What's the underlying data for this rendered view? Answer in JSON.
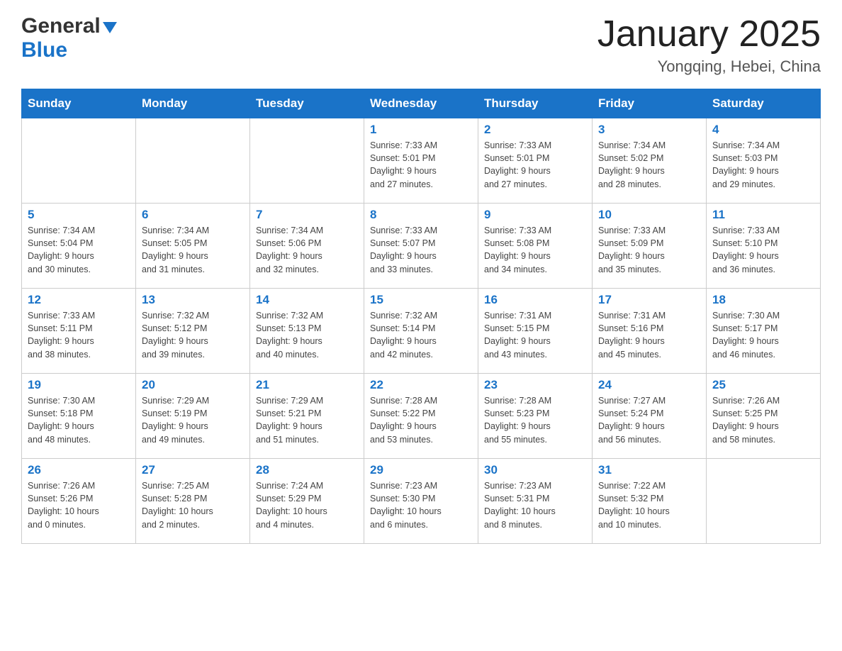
{
  "header": {
    "logo_general": "General",
    "logo_blue": "Blue",
    "title": "January 2025",
    "subtitle": "Yongqing, Hebei, China"
  },
  "days_of_week": [
    "Sunday",
    "Monday",
    "Tuesday",
    "Wednesday",
    "Thursday",
    "Friday",
    "Saturday"
  ],
  "weeks": [
    [
      {
        "day": "",
        "info": ""
      },
      {
        "day": "",
        "info": ""
      },
      {
        "day": "",
        "info": ""
      },
      {
        "day": "1",
        "info": "Sunrise: 7:33 AM\nSunset: 5:01 PM\nDaylight: 9 hours\nand 27 minutes."
      },
      {
        "day": "2",
        "info": "Sunrise: 7:33 AM\nSunset: 5:01 PM\nDaylight: 9 hours\nand 27 minutes."
      },
      {
        "day": "3",
        "info": "Sunrise: 7:34 AM\nSunset: 5:02 PM\nDaylight: 9 hours\nand 28 minutes."
      },
      {
        "day": "4",
        "info": "Sunrise: 7:34 AM\nSunset: 5:03 PM\nDaylight: 9 hours\nand 29 minutes."
      }
    ],
    [
      {
        "day": "5",
        "info": "Sunrise: 7:34 AM\nSunset: 5:04 PM\nDaylight: 9 hours\nand 30 minutes."
      },
      {
        "day": "6",
        "info": "Sunrise: 7:34 AM\nSunset: 5:05 PM\nDaylight: 9 hours\nand 31 minutes."
      },
      {
        "day": "7",
        "info": "Sunrise: 7:34 AM\nSunset: 5:06 PM\nDaylight: 9 hours\nand 32 minutes."
      },
      {
        "day": "8",
        "info": "Sunrise: 7:33 AM\nSunset: 5:07 PM\nDaylight: 9 hours\nand 33 minutes."
      },
      {
        "day": "9",
        "info": "Sunrise: 7:33 AM\nSunset: 5:08 PM\nDaylight: 9 hours\nand 34 minutes."
      },
      {
        "day": "10",
        "info": "Sunrise: 7:33 AM\nSunset: 5:09 PM\nDaylight: 9 hours\nand 35 minutes."
      },
      {
        "day": "11",
        "info": "Sunrise: 7:33 AM\nSunset: 5:10 PM\nDaylight: 9 hours\nand 36 minutes."
      }
    ],
    [
      {
        "day": "12",
        "info": "Sunrise: 7:33 AM\nSunset: 5:11 PM\nDaylight: 9 hours\nand 38 minutes."
      },
      {
        "day": "13",
        "info": "Sunrise: 7:32 AM\nSunset: 5:12 PM\nDaylight: 9 hours\nand 39 minutes."
      },
      {
        "day": "14",
        "info": "Sunrise: 7:32 AM\nSunset: 5:13 PM\nDaylight: 9 hours\nand 40 minutes."
      },
      {
        "day": "15",
        "info": "Sunrise: 7:32 AM\nSunset: 5:14 PM\nDaylight: 9 hours\nand 42 minutes."
      },
      {
        "day": "16",
        "info": "Sunrise: 7:31 AM\nSunset: 5:15 PM\nDaylight: 9 hours\nand 43 minutes."
      },
      {
        "day": "17",
        "info": "Sunrise: 7:31 AM\nSunset: 5:16 PM\nDaylight: 9 hours\nand 45 minutes."
      },
      {
        "day": "18",
        "info": "Sunrise: 7:30 AM\nSunset: 5:17 PM\nDaylight: 9 hours\nand 46 minutes."
      }
    ],
    [
      {
        "day": "19",
        "info": "Sunrise: 7:30 AM\nSunset: 5:18 PM\nDaylight: 9 hours\nand 48 minutes."
      },
      {
        "day": "20",
        "info": "Sunrise: 7:29 AM\nSunset: 5:19 PM\nDaylight: 9 hours\nand 49 minutes."
      },
      {
        "day": "21",
        "info": "Sunrise: 7:29 AM\nSunset: 5:21 PM\nDaylight: 9 hours\nand 51 minutes."
      },
      {
        "day": "22",
        "info": "Sunrise: 7:28 AM\nSunset: 5:22 PM\nDaylight: 9 hours\nand 53 minutes."
      },
      {
        "day": "23",
        "info": "Sunrise: 7:28 AM\nSunset: 5:23 PM\nDaylight: 9 hours\nand 55 minutes."
      },
      {
        "day": "24",
        "info": "Sunrise: 7:27 AM\nSunset: 5:24 PM\nDaylight: 9 hours\nand 56 minutes."
      },
      {
        "day": "25",
        "info": "Sunrise: 7:26 AM\nSunset: 5:25 PM\nDaylight: 9 hours\nand 58 minutes."
      }
    ],
    [
      {
        "day": "26",
        "info": "Sunrise: 7:26 AM\nSunset: 5:26 PM\nDaylight: 10 hours\nand 0 minutes."
      },
      {
        "day": "27",
        "info": "Sunrise: 7:25 AM\nSunset: 5:28 PM\nDaylight: 10 hours\nand 2 minutes."
      },
      {
        "day": "28",
        "info": "Sunrise: 7:24 AM\nSunset: 5:29 PM\nDaylight: 10 hours\nand 4 minutes."
      },
      {
        "day": "29",
        "info": "Sunrise: 7:23 AM\nSunset: 5:30 PM\nDaylight: 10 hours\nand 6 minutes."
      },
      {
        "day": "30",
        "info": "Sunrise: 7:23 AM\nSunset: 5:31 PM\nDaylight: 10 hours\nand 8 minutes."
      },
      {
        "day": "31",
        "info": "Sunrise: 7:22 AM\nSunset: 5:32 PM\nDaylight: 10 hours\nand 10 minutes."
      },
      {
        "day": "",
        "info": ""
      }
    ]
  ]
}
